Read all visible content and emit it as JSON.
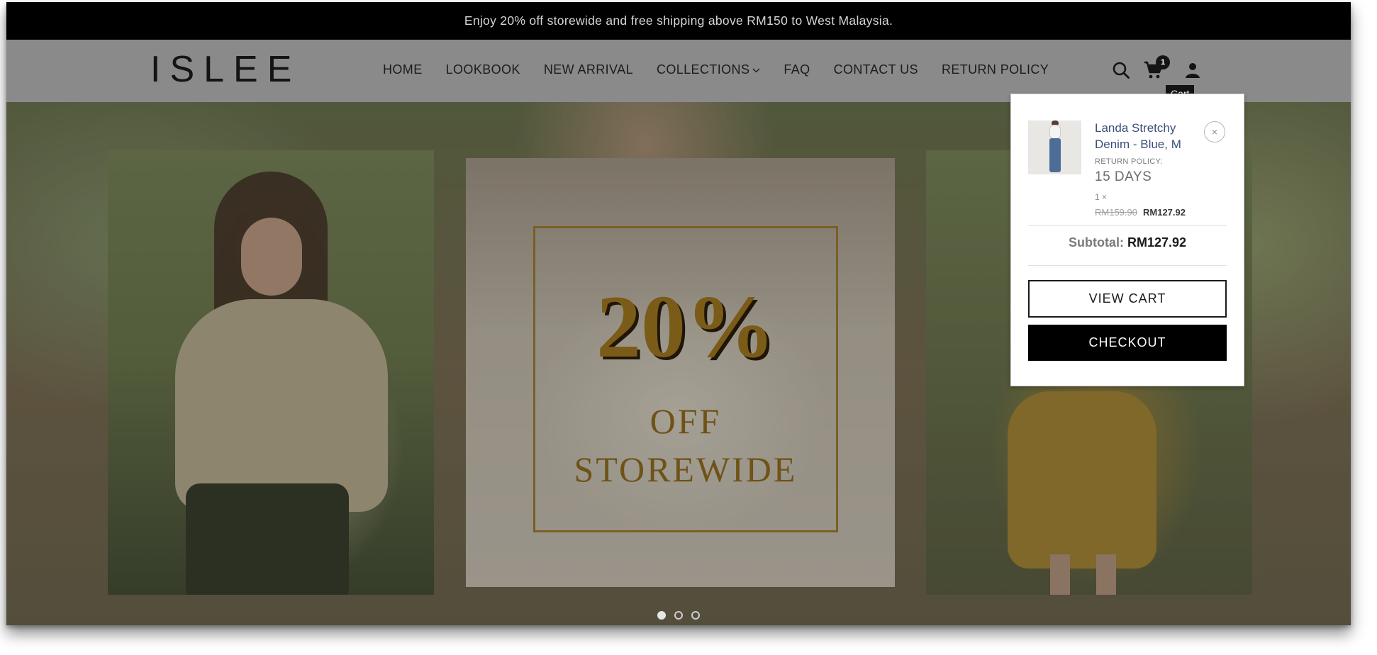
{
  "announcement": "Enjoy 20% off storewide and free shipping above RM150 to West Malaysia.",
  "header": {
    "logo": "ISLEE",
    "nav": [
      {
        "label": "HOME"
      },
      {
        "label": "LOOKBOOK"
      },
      {
        "label": "NEW ARRIVAL"
      },
      {
        "label": "COLLECTIONS",
        "has_dropdown": true
      },
      {
        "label": "FAQ"
      },
      {
        "label": "CONTACT US"
      },
      {
        "label": "RETURN POLICY"
      }
    ],
    "icons": [
      "search-icon",
      "cart-icon",
      "account-icon"
    ],
    "cart_count": "1",
    "cart_tooltip": "Cart"
  },
  "hero": {
    "big_text": "20%",
    "line1": "OFF",
    "line2": "STOREWIDE",
    "slides": 3,
    "active_slide": 1
  },
  "cart": {
    "item": {
      "name": "Landa Stretchy Denim - Blue, M",
      "return_policy_label": "RETURN POLICY:",
      "return_policy_value": "15 DAYS",
      "quantity": "1 ×",
      "original_price": "RM159.90",
      "price": "RM127.92"
    },
    "subtotal_label": "Subtotal:",
    "subtotal_value": "RM127.92",
    "view_cart_label": "VIEW CART",
    "checkout_label": "CHECKOUT"
  },
  "colors": {
    "announcement_bg": "#000000",
    "header_bg": "#8a8a8a",
    "promo_gold": "#7a5b18",
    "link_blue": "#3a4f7a"
  }
}
